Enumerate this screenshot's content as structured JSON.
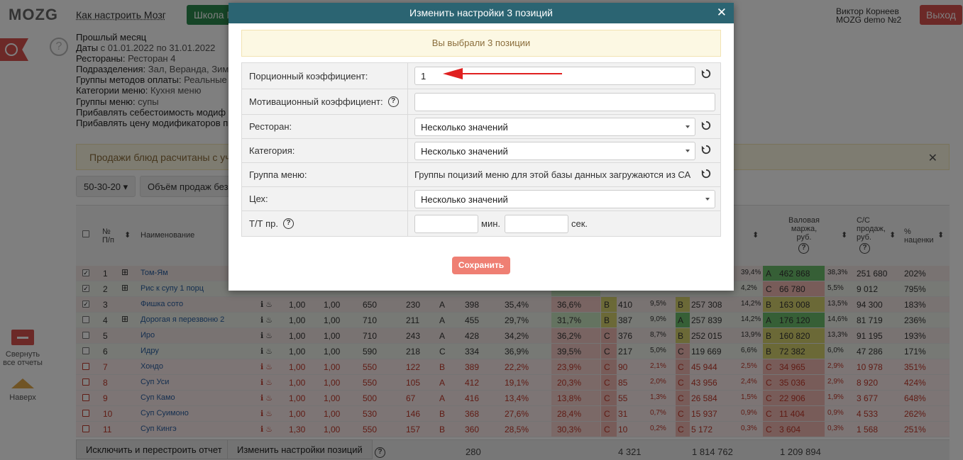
{
  "header": {
    "logo": "MOZG",
    "howto": "Как настроить Мозг",
    "school": "Школа М",
    "user_name": "Виктор Корнеев",
    "user_company": "MOZG demo №2",
    "logout": "Выход"
  },
  "filters": [
    {
      "label": "Прошлый месяц",
      "value": ""
    },
    {
      "label": "Даты",
      "value": "с 01.01.2022 по 31.01.2022"
    },
    {
      "label": "Рестораны:",
      "value": "Ресторан 4"
    },
    {
      "label": "Подразделения:",
      "value": "Зал, Веранда, Зим"
    },
    {
      "label": "Группы методов оплаты:",
      "value": "Реальные"
    },
    {
      "label": "Категории меню:",
      "value": "Кухня меню"
    },
    {
      "label": "Группы меню:",
      "value": "супы"
    },
    {
      "label": "Прибавлять себестоимость модиф",
      "value": ""
    },
    {
      "label": "Прибавлять цену модификаторов п",
      "value": ""
    }
  ],
  "notice": "Продажи блюд расчитаны с учет",
  "controls": {
    "abc": "50-30-20",
    "volume": "Объём продаж без"
  },
  "sidebar": {
    "collapse": "Свернуть все отчеты",
    "up": "Наверх"
  },
  "table": {
    "headers": {
      "num": "№ П/п",
      "name": "Наименование",
      "gross_margin": "Валовая маржа, руб.",
      "cs": "С/С продаж, руб.",
      "markup": "% наценки"
    },
    "rows": [
      {
        "checked": true,
        "n": "1",
        "plus": true,
        "name": "Том-Ям",
        "k1": "",
        "k2": "",
        "p": "",
        "q": "",
        "abc": "",
        "price": "",
        "pct": "",
        "pct2": "",
        "g1": "",
        "v1": "",
        "v1p": "",
        "g2": "",
        "v2": "",
        "v2p": "39,4%",
        "g3": "A",
        "v3": "462 868",
        "v3p": "38,3%",
        "cs": "251 680",
        "mk": "202%",
        "red": false
      },
      {
        "checked": true,
        "n": "2",
        "plus": true,
        "name": "Рис к супу 1 порц",
        "k1": "",
        "k2": "",
        "p": "",
        "q": "",
        "abc": "",
        "price": "",
        "pct": "",
        "pct2": "",
        "g1": "",
        "v1": "",
        "v1p": "",
        "g2": "",
        "v2": "",
        "v2p": "4,2%",
        "g3": "C",
        "v3": "66 780",
        "v3p": "5,5%",
        "cs": "9 012",
        "mk": "795%",
        "red": false
      },
      {
        "checked": true,
        "n": "3",
        "plus": false,
        "name": "Фишка сото",
        "k1": "1,00",
        "k2": "1,00",
        "p": "650",
        "q": "230",
        "abc": "A",
        "price": "398",
        "pct": "35,4%",
        "pct2": "36,6%",
        "g1": "B",
        "v1": "410",
        "v1p": "9,5%",
        "g2": "B",
        "v2": "257 308",
        "v2p": "14,2%",
        "g3": "B",
        "v3": "163 008",
        "v3p": "13,5%",
        "cs": "94 300",
        "mk": "183%",
        "red": false
      },
      {
        "checked": false,
        "n": "4",
        "plus": true,
        "name": "Дорогая я перезвоню 2",
        "k1": "1,00",
        "k2": "1,00",
        "p": "710",
        "q": "211",
        "abc": "A",
        "price": "455",
        "pct": "29,7%",
        "pct2": "31,7%",
        "g1": "B",
        "v1": "387",
        "v1p": "9,0%",
        "g2": "A",
        "v2": "257 839",
        "v2p": "14,2%",
        "g3": "A",
        "v3": "176 120",
        "v3p": "14,6%",
        "cs": "81 719",
        "mk": "236%",
        "red": false
      },
      {
        "checked": false,
        "n": "5",
        "plus": false,
        "name": "Иро",
        "k1": "1,00",
        "k2": "1,00",
        "p": "710",
        "q": "243",
        "abc": "A",
        "price": "428",
        "pct": "34,2%",
        "pct2": "36,2%",
        "g1": "C",
        "v1": "376",
        "v1p": "8,7%",
        "g2": "B",
        "v2": "252 015",
        "v2p": "13,9%",
        "g3": "B",
        "v3": "160 820",
        "v3p": "13,3%",
        "cs": "91 195",
        "mk": "193%",
        "red": false
      },
      {
        "checked": false,
        "n": "6",
        "plus": false,
        "name": "Идру",
        "k1": "1,00",
        "k2": "1,00",
        "p": "590",
        "q": "218",
        "abc": "C",
        "price": "334",
        "pct": "36,9%",
        "pct2": "39,5%",
        "g1": "C",
        "v1": "217",
        "v1p": "5,0%",
        "g2": "C",
        "v2": "119 669",
        "v2p": "6,6%",
        "g3": "B",
        "v3": "72 382",
        "v3p": "6,0%",
        "cs": "47 286",
        "mk": "171%",
        "red": false
      },
      {
        "checked": false,
        "n": "7",
        "plus": false,
        "name": "Хондо",
        "k1": "1,00",
        "k2": "1,00",
        "p": "550",
        "q": "122",
        "abc": "B",
        "price": "389",
        "pct": "22,2%",
        "pct2": "23,9%",
        "g1": "C",
        "v1": "90",
        "v1p": "2,1%",
        "g2": "C",
        "v2": "45 944",
        "v2p": "2,5%",
        "g3": "C",
        "v3": "34 965",
        "v3p": "2,9%",
        "cs": "10 978",
        "mk": "351%",
        "red": true
      },
      {
        "checked": false,
        "n": "8",
        "plus": false,
        "name": "Суп Уси",
        "k1": "1,00",
        "k2": "1,00",
        "p": "550",
        "q": "105",
        "abc": "A",
        "price": "412",
        "pct": "19,1%",
        "pct2": "20,3%",
        "g1": "C",
        "v1": "85",
        "v1p": "2,0%",
        "g2": "C",
        "v2": "43 956",
        "v2p": "2,4%",
        "g3": "C",
        "v3": "35 036",
        "v3p": "2,9%",
        "cs": "8 920",
        "mk": "424%",
        "red": true
      },
      {
        "checked": false,
        "n": "9",
        "plus": false,
        "name": "Суп Камо",
        "k1": "1,00",
        "k2": "1,00",
        "p": "500",
        "q": "67",
        "abc": "A",
        "price": "416",
        "pct": "13,4%",
        "pct2": "13,8%",
        "g1": "C",
        "v1": "55",
        "v1p": "1,3%",
        "g2": "C",
        "v2": "26 584",
        "v2p": "1,5%",
        "g3": "C",
        "v3": "22 906",
        "v3p": "1,9%",
        "cs": "3 677",
        "mk": "648%",
        "red": true
      },
      {
        "checked": false,
        "n": "10",
        "plus": false,
        "name": "Суп Суимоно",
        "k1": "1,00",
        "k2": "1,00",
        "p": "530",
        "q": "146",
        "abc": "B",
        "price": "368",
        "pct": "27,6%",
        "pct2": "28,4%",
        "g1": "C",
        "v1": "31",
        "v1p": "0,7%",
        "g2": "C",
        "v2": "15 937",
        "v2p": "0,9%",
        "g3": "C",
        "v3": "11 404",
        "v3p": "0,9%",
        "cs": "4 533",
        "mk": "262%",
        "red": true
      },
      {
        "checked": false,
        "n": "11",
        "plus": false,
        "name": "Суп Кингэ",
        "k1": "1,30",
        "k2": "1,00",
        "p": "550",
        "q": "157",
        "abc": "B",
        "price": "360",
        "pct": "28,5%",
        "pct2": "30,3%",
        "g1": "C",
        "v1": "10",
        "v1p": "0,2%",
        "g2": "C",
        "v2": "5 172",
        "v2p": "0,3%",
        "g3": "C",
        "v3": "3 604",
        "v3p": "0,3%",
        "cs": "1 568",
        "mk": "251%",
        "red": true
      }
    ],
    "totals": {
      "q": "280",
      "v1": "4 321",
      "v2": "1 814 762",
      "v3": "1 209 894"
    }
  },
  "footer": {
    "rebuild": "Исключить и перестроить отчет",
    "change": "Изменить настройки позиций"
  },
  "modal": {
    "title": "Изменить настройки 3 позиций",
    "selected": "Вы выбрали 3 позиции",
    "fields": {
      "portion_label": "Порционный коэффициент:",
      "portion_value": "1",
      "motiv_label": "Мотивационный коэффициент:",
      "motiv_value": "",
      "restaurant_label": "Ресторан:",
      "restaurant_value": "Несколько значений",
      "category_label": "Категория:",
      "category_value": "Несколько значений",
      "group_label": "Группа меню:",
      "group_value": "Группы поцизий меню для этой базы данных загружаются из СА",
      "shop_label": "Цех:",
      "shop_value": "Несколько значений",
      "tt_label": "Т/Т пр.",
      "min_unit": "мин.",
      "sec_unit": "сек."
    },
    "save": "Сохранить"
  },
  "colors": {
    "modal_header": "#2b6472",
    "save": "#ef7f73",
    "logout": "#d9534f",
    "school": "#2d8a4f",
    "alert_bg": "#fcf8e3",
    "arrow": "#e02020"
  }
}
